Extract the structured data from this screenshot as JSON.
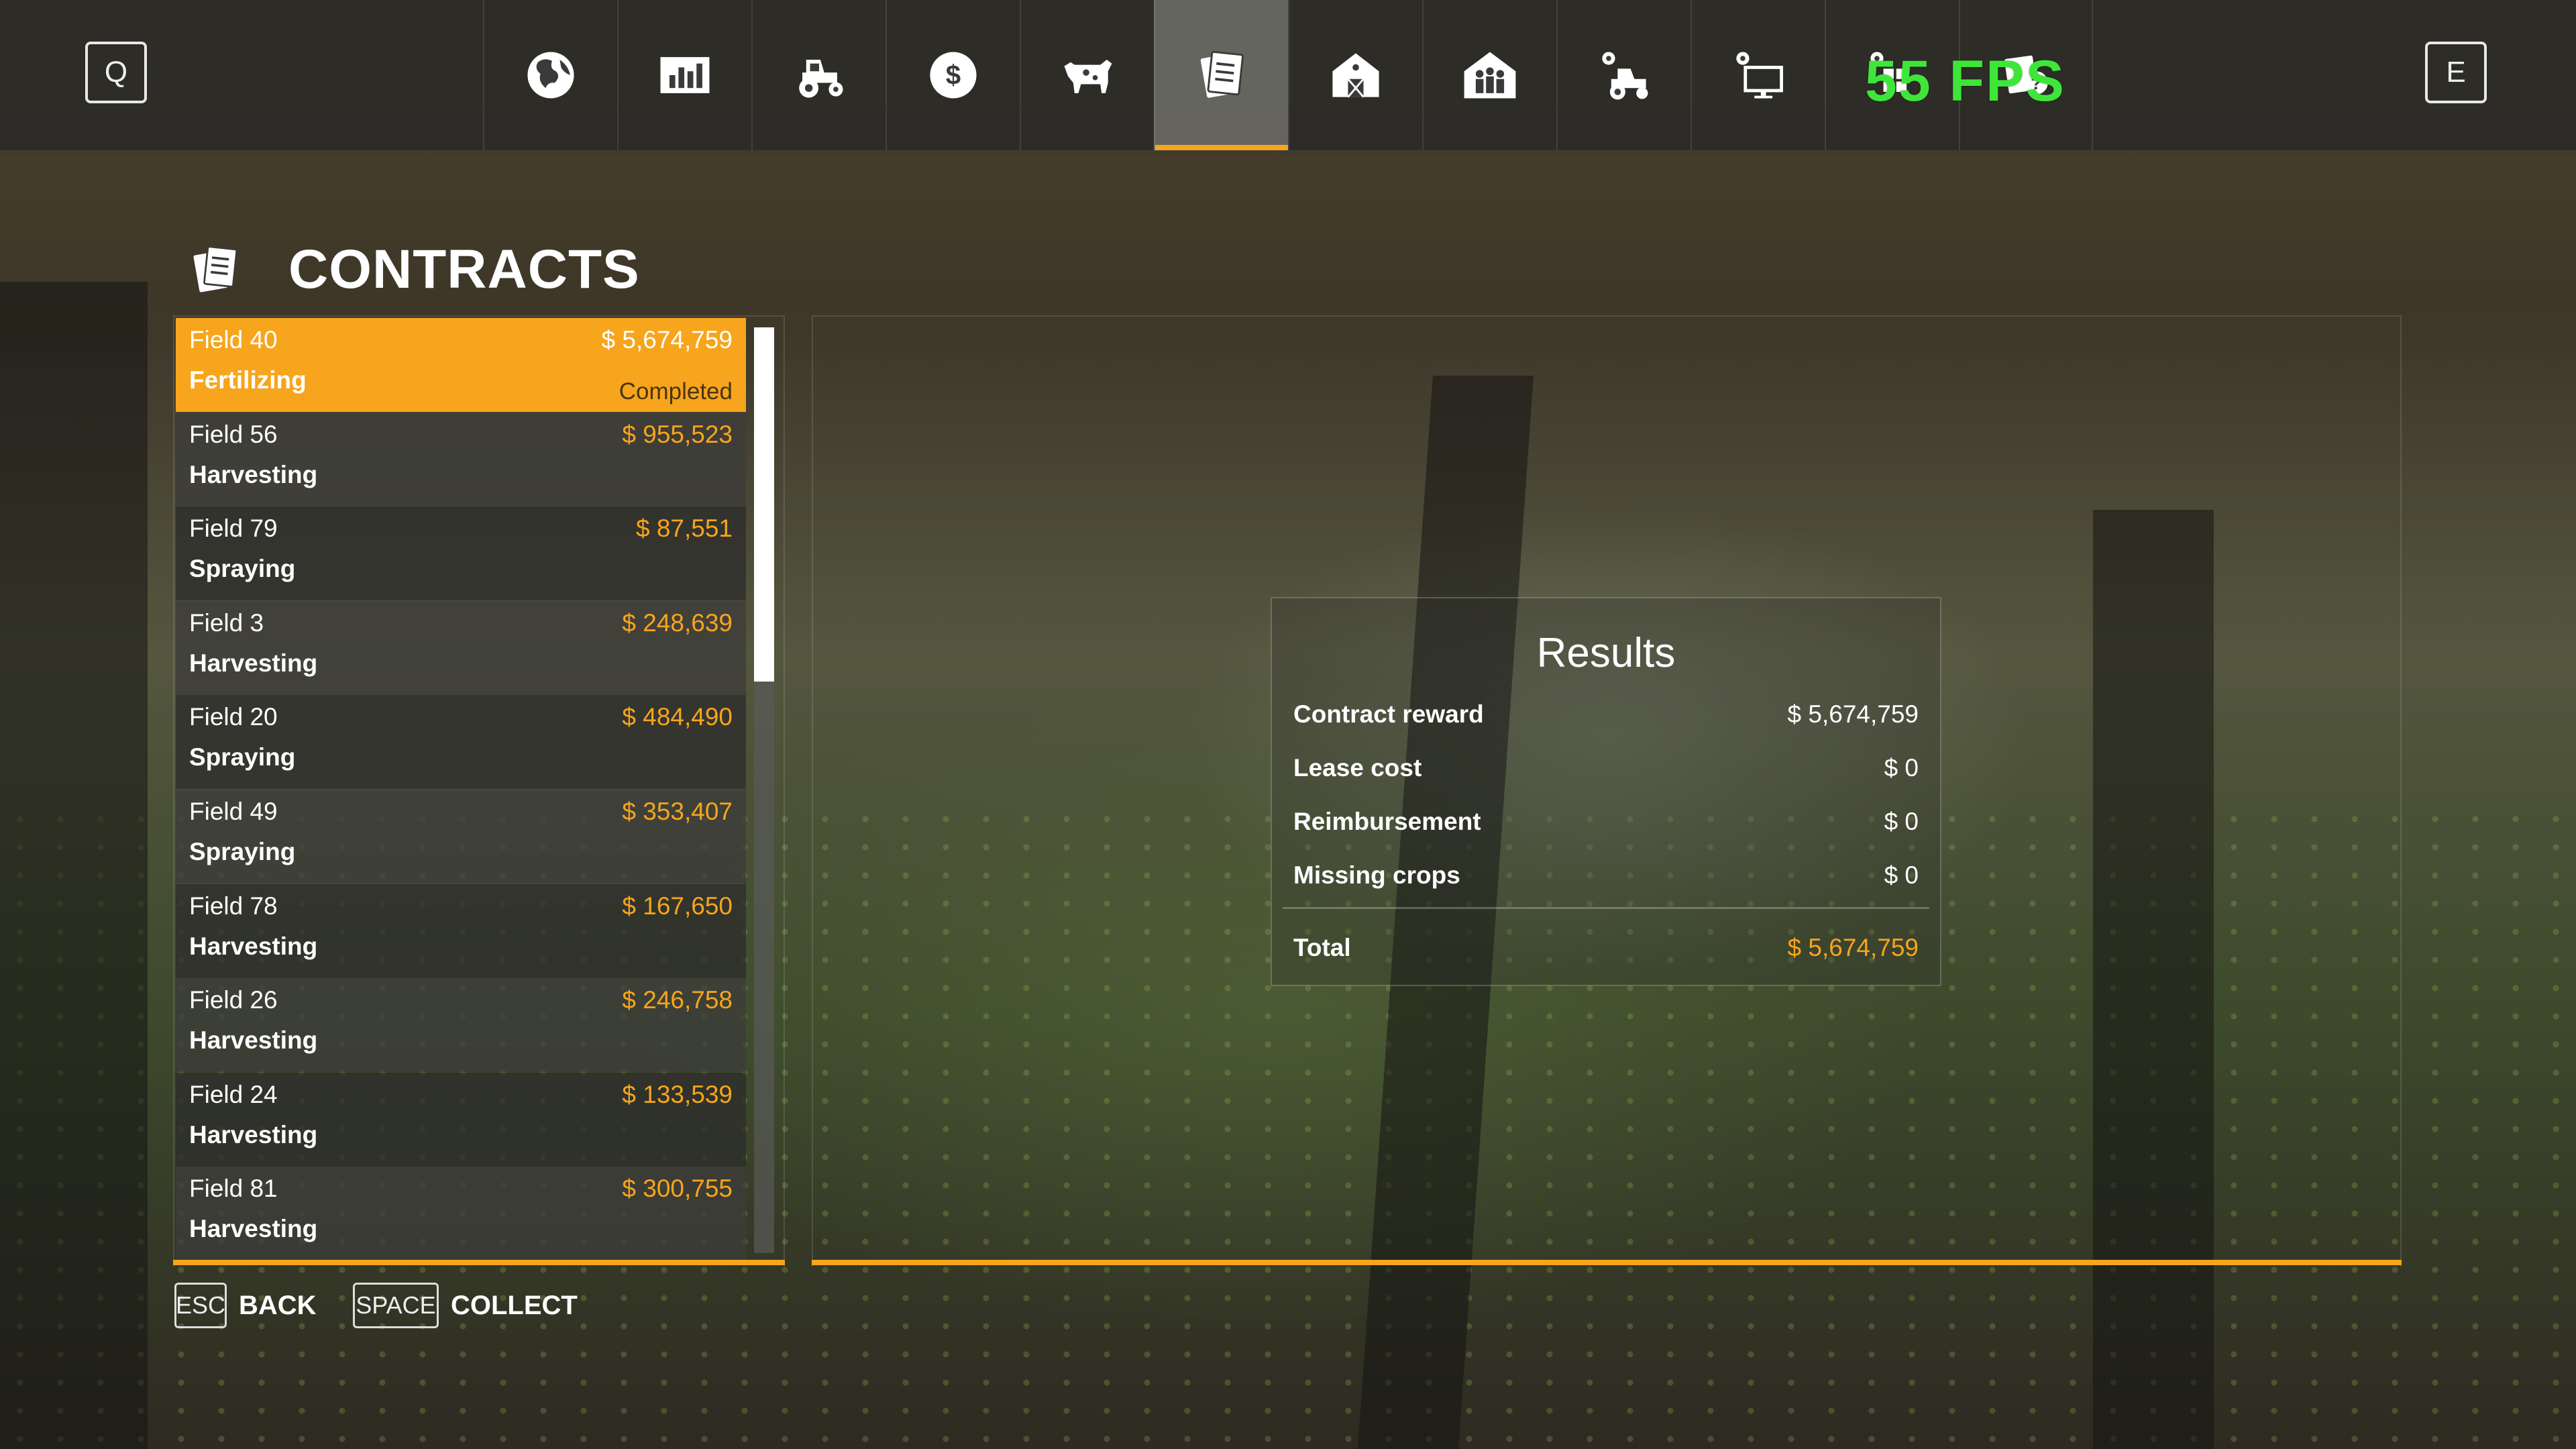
{
  "topbar": {
    "left_key": "Q",
    "right_key": "E",
    "fps": "55 FPS",
    "tabs": [
      {
        "icon": "globe-icon"
      },
      {
        "icon": "statistics-icon"
      },
      {
        "icon": "tractor-icon"
      },
      {
        "icon": "finances-icon"
      },
      {
        "icon": "animals-icon"
      },
      {
        "icon": "contracts-icon",
        "active": true
      },
      {
        "icon": "barn-icon"
      },
      {
        "icon": "workers-icon"
      },
      {
        "icon": "vehicle-settings-icon"
      },
      {
        "icon": "display-settings-icon"
      },
      {
        "icon": "general-settings-icon"
      },
      {
        "icon": "help-icon"
      }
    ]
  },
  "page": {
    "title": "CONTRACTS"
  },
  "contracts": [
    {
      "field": "Field 40",
      "type": "Fertilizing",
      "reward": "$ 5,674,759",
      "status": "Completed"
    },
    {
      "field": "Field 56",
      "type": "Harvesting",
      "reward": "$ 955,523"
    },
    {
      "field": "Field 79",
      "type": "Spraying",
      "reward": "$ 87,551"
    },
    {
      "field": "Field 3",
      "type": "Harvesting",
      "reward": "$ 248,639"
    },
    {
      "field": "Field 20",
      "type": "Spraying",
      "reward": "$ 484,490"
    },
    {
      "field": "Field 49",
      "type": "Spraying",
      "reward": "$ 353,407"
    },
    {
      "field": "Field 78",
      "type": "Harvesting",
      "reward": "$ 167,650"
    },
    {
      "field": "Field 26",
      "type": "Harvesting",
      "reward": "$ 246,758"
    },
    {
      "field": "Field 24",
      "type": "Harvesting",
      "reward": "$ 133,539"
    },
    {
      "field": "Field 81",
      "type": "Harvesting",
      "reward": "$ 300,755"
    }
  ],
  "results": {
    "title": "Results",
    "rows": [
      {
        "label": "Contract reward",
        "value": "$ 5,674,759"
      },
      {
        "label": "Lease cost",
        "value": "$ 0"
      },
      {
        "label": "Reimbursement",
        "value": "$ 0"
      },
      {
        "label": "Missing crops",
        "value": "$ 0"
      }
    ],
    "total": {
      "label": "Total",
      "value": "$ 5,674,759"
    }
  },
  "footer": {
    "back": {
      "key": "ESC",
      "label": "BACK"
    },
    "collect": {
      "key": "SPACE",
      "label": "COLLECT"
    }
  },
  "colors": {
    "accent": "#f7a51c",
    "fps": "#3ee63a"
  }
}
